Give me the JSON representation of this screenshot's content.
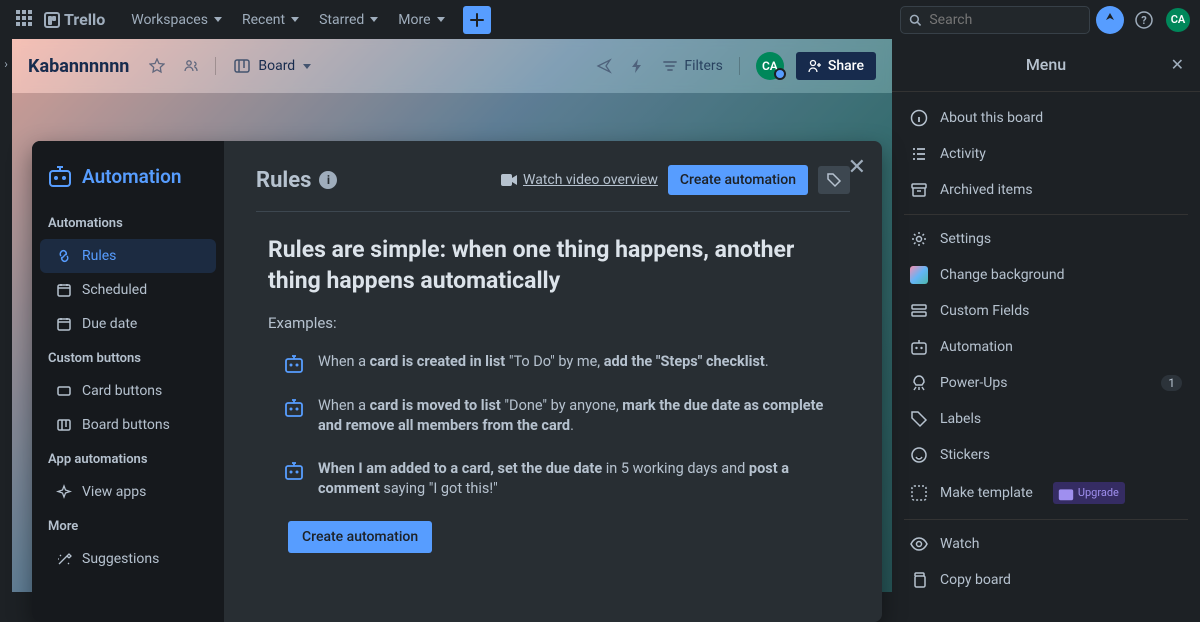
{
  "topnav": {
    "brand": "Trello",
    "items": [
      "Workspaces",
      "Recent",
      "Starred",
      "More"
    ],
    "search_placeholder": "Search",
    "avatar_initials": "CA"
  },
  "board": {
    "title": "Kabannnnnn",
    "view_label": "Board",
    "filters_label": "Filters",
    "share_label": "Share",
    "avatar_initials": "CA"
  },
  "automation": {
    "panel_title": "Automation",
    "sections": {
      "automations": "Automations",
      "custom_buttons": "Custom buttons",
      "app_automations": "App automations",
      "more": "More"
    },
    "sidebar": {
      "rules": "Rules",
      "scheduled": "Scheduled",
      "due_date": "Due date",
      "card_buttons": "Card buttons",
      "board_buttons": "Board buttons",
      "view_apps": "View apps",
      "suggestions": "Suggestions"
    },
    "content": {
      "title": "Rules",
      "video_link": "Watch video overview",
      "create_label": "Create automation",
      "heading": "Rules are simple: when one thing happens, another thing happens automatically",
      "examples_label": "Examples:",
      "examples": [
        {
          "pre": "When a ",
          "b1": "card is created in list",
          "mid1": " \"To Do\" by me, ",
          "b2": "add the \"Steps\" checklist",
          "post": "."
        },
        {
          "pre": "When a ",
          "b1": "card is moved to list",
          "mid1": " \"Done\" by anyone, ",
          "b2": "mark the due date as complete and remove all members from the card",
          "post": "."
        },
        {
          "pre": "",
          "b1": "When I am added to a card, set the due date",
          "mid1": " in 5 working days and ",
          "b2": "post a comment",
          "post": " saying \"I got this!\""
        }
      ],
      "create_label_2": "Create automation"
    }
  },
  "menu": {
    "title": "Menu",
    "items": {
      "about": "About this board",
      "activity": "Activity",
      "archived": "Archived items",
      "settings": "Settings",
      "change_bg": "Change background",
      "custom_fields": "Custom Fields",
      "automation": "Automation",
      "powerups": "Power-Ups",
      "powerups_count": "1",
      "labels": "Labels",
      "stickers": "Stickers",
      "make_template": "Make template",
      "upgrade": "Upgrade",
      "watch": "Watch",
      "copy": "Copy board"
    }
  }
}
